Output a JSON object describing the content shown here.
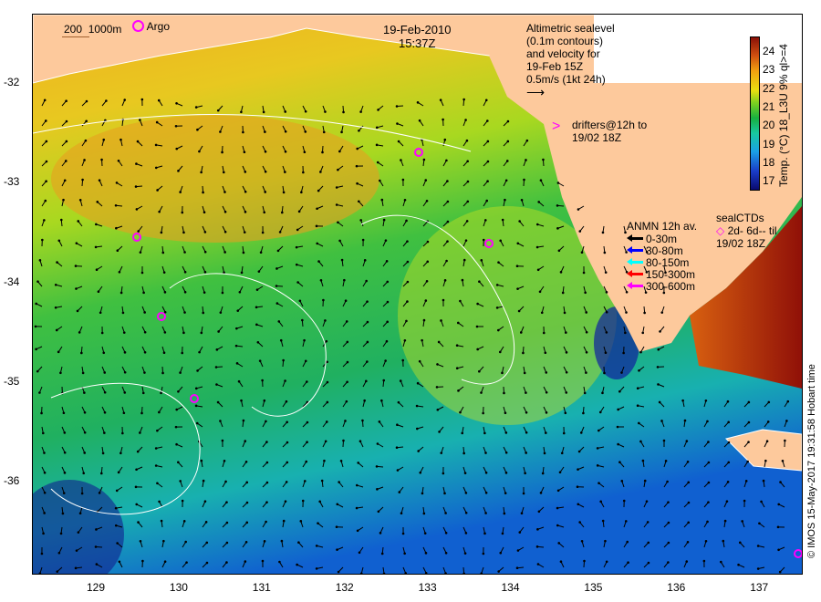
{
  "title": {
    "date": "19-Feb-2010",
    "time": "15:37Z"
  },
  "scale": {
    "label1": "200",
    "label2": "1000m"
  },
  "argo_label": "Argo",
  "altimetry": {
    "lines": [
      "Altimetric sealevel",
      "(0.1m contours)",
      "and velocity for",
      "19-Feb 15Z",
      "0.5m/s (1kt 24h)"
    ]
  },
  "drifters": {
    "lines": [
      "drifters@12h to",
      "19/02 18Z"
    ]
  },
  "anmn": {
    "title": "ANMN 12h av.",
    "items": [
      {
        "label": "0-30m",
        "color": "#000000"
      },
      {
        "label": "30-80m",
        "color": "#0000ff"
      },
      {
        "label": "80-150m",
        "color": "#00ffff"
      },
      {
        "label": "150-300m",
        "color": "#ff0000"
      },
      {
        "label": "300-600m",
        "color": "#ff00ff"
      }
    ]
  },
  "sealctds": {
    "title": "sealCTDs",
    "line1": "2d- 6d-- til",
    "line2": "19/02 18Z"
  },
  "colorbar": {
    "title": "Temp. (°C) 18_L3U 9% ql>=4",
    "ticks": [
      "24",
      "23",
      "22",
      "21",
      "20",
      "19",
      "18",
      "17"
    ]
  },
  "lat_ticks": [
    "-32",
    "-33",
    "-34",
    "-35",
    "-36"
  ],
  "lon_ticks": [
    "129",
    "130",
    "131",
    "132",
    "133",
    "134",
    "135",
    "136",
    "137"
  ],
  "credit": "© IMOS 15-May-2017 19:31:58 Hobart time",
  "colors": {
    "land": "#fdc99c",
    "argo": "#ff00ff"
  }
}
